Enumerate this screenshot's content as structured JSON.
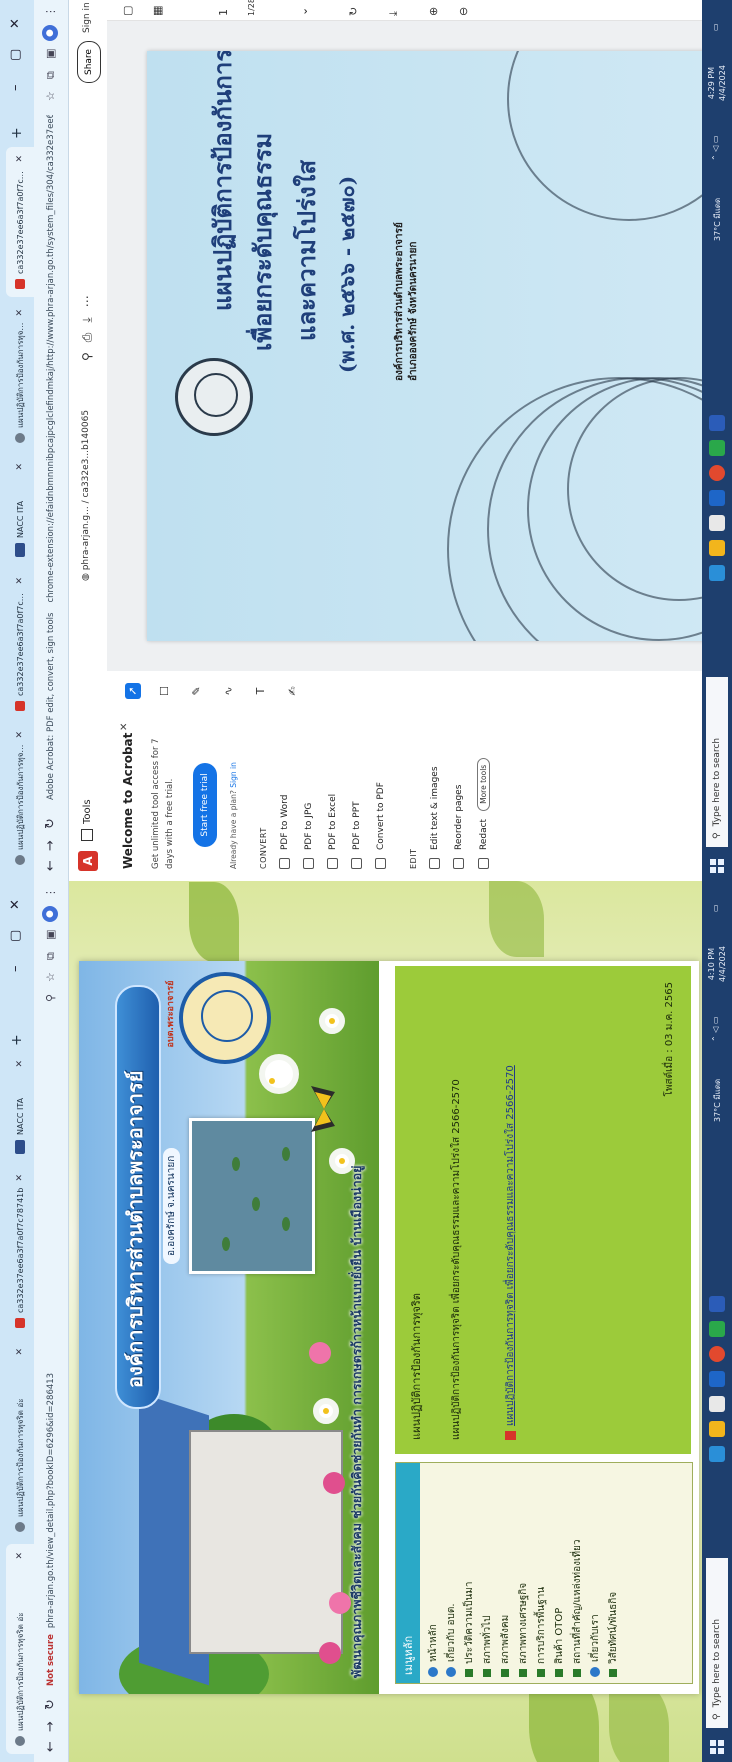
{
  "left": {
    "tabs": [
      {
        "label": "แผนปฏิบัติการป้องกันการทุจริต อ่ะ"
      },
      {
        "label": "แผนปฏิบัติการป้องกันการทุจริต อ่ะ"
      },
      {
        "label": "ca332e37ee6a3f7a0f7c78741b"
      },
      {
        "label": "NACC ITA"
      }
    ],
    "url": {
      "warning": "Not secure",
      "text": "phra-arjan.go.th/view_detail.php?bookID=6296&id=286413"
    },
    "site": {
      "org_name": "องค์การบริหารส่วนตำบลพระอาจารย์",
      "org_sub": "อ.องครักษ์ จ.นครนายก",
      "seal_text": "อบต.พระอาจารย์",
      "slogan": "พัฒนาคุณภาพชีวิตและสังคม ช่วยกันคิดช่วยกันทำ การเกษตรก้าวหน้าแบบยั่งยืน บ้านเมืองน่าอยู่",
      "menu_title": "เมนูหลัก",
      "menu": [
        {
          "label": "หน้าหลัก",
          "type": "cat"
        },
        {
          "label": "เกี่ยวกับ อบต.",
          "type": "cat"
        },
        {
          "label": "ประวัติความเป็นมา",
          "type": "item"
        },
        {
          "label": "สภาพทั่วไป",
          "type": "item"
        },
        {
          "label": "สภาพสังคม",
          "type": "item"
        },
        {
          "label": "สภาพทางเศรษฐกิจ",
          "type": "item"
        },
        {
          "label": "การบริการพื้นฐาน",
          "type": "item"
        },
        {
          "label": "สินค้า OTOP",
          "type": "item"
        },
        {
          "label": "สถานที่สำคัญ/แหล่งท่องเที่ยว",
          "type": "item"
        },
        {
          "label": "เกี่ยวกับเรา",
          "type": "cat"
        },
        {
          "label": "วิสัยทัศน์/พันธกิจ",
          "type": "item"
        }
      ],
      "content_title": "แผนปฏิบัติการป้องกันการทุจริต",
      "content_desc": "แผนปฏิบัติการป้องกันการทุจริต เพื่อยกระดับคุณธรรมและความโปร่งใส 2566-2570",
      "content_link": "แผนปฏิบัติการป้องกันการทุจริต เพื่อยกระดับคุณธรรมและความโปร่งใส 2566-2570",
      "content_date": "โพสต์เมื่อ : 03 ม.ค. 2565"
    },
    "taskbar": {
      "search": "Type here to search",
      "weather": "37°C มีแดด",
      "time": "4:10 PM",
      "date": "4/4/2024"
    }
  },
  "right": {
    "tabs": [
      {
        "label": "แผนปฏิบัติการป้องกันการทุจริต"
      },
      {
        "label": "ca332e37ee6a3f7a0f7c7874"
      },
      {
        "label": "NACC ITA"
      },
      {
        "label": "แผนปฏิบัติการป้องกันการทุจริต"
      },
      {
        "label": "ca332e37ee6a3f7a0f7c7874"
      }
    ],
    "url": {
      "prefix": "Adobe Acrobat: PDF edit, convert, sign tools",
      "text": "chrome-extension://efaidnbmnnnibpcajpcglclefindmkaj/http://www.phra-arjan.go.th/system_files/304/ca332e37ee6a3f..."
    },
    "acrobat": {
      "tools_label": "Tools",
      "file_prefix": "phra-arjan.g...",
      "file_name": "ca332e3...b140065",
      "share": "Share",
      "signin": "Sign in",
      "welcome": "Welcome to Acrobat",
      "desc": "Get unlimited tool access for 7 days with a free trial.",
      "trial_btn": "Start free trial",
      "plan_text": "Already have a plan?",
      "plan_link": "Sign in",
      "convert_head": "CONVERT",
      "convert_items": [
        {
          "label": "PDF to Word"
        },
        {
          "label": "PDF to JPG"
        },
        {
          "label": "PDF to Excel"
        },
        {
          "label": "PDF to PPT"
        },
        {
          "label": "Convert to PDF"
        }
      ],
      "edit_head": "EDIT",
      "edit_items": [
        {
          "label": "Edit text & images"
        },
        {
          "label": "Reorder pages"
        },
        {
          "label": "Redact"
        }
      ],
      "more_tools": "More tools",
      "pdf_title_1": "แผนปฏิบัติการป้องกันการทุจริต",
      "pdf_title_2": "เพื่อยกระดับคุณธรรม",
      "pdf_title_3": "และความโปร่งใส",
      "pdf_title_4": "(พ.ศ. ๒๕๖๖ - ๒๕๗๐)",
      "pdf_note_1": "องค์การบริหารส่วนตำบลพระอาจารย์",
      "pdf_note_2": "อำเภอองครักษ์ จังหวัดนครนายก"
    },
    "taskbar": {
      "search": "Type here to search",
      "weather": "37°C มีแดด",
      "time": "4:29 PM",
      "date": "4/4/2024"
    }
  },
  "colors": {
    "taskbar": "#1e3f6e",
    "tabstrip": "#cfe6f7",
    "menu_header": "#2aa9c7",
    "content_bg": "#9ccb3a",
    "acrobat_blue": "#1473e6",
    "acrobat_red": "#d6342a"
  }
}
